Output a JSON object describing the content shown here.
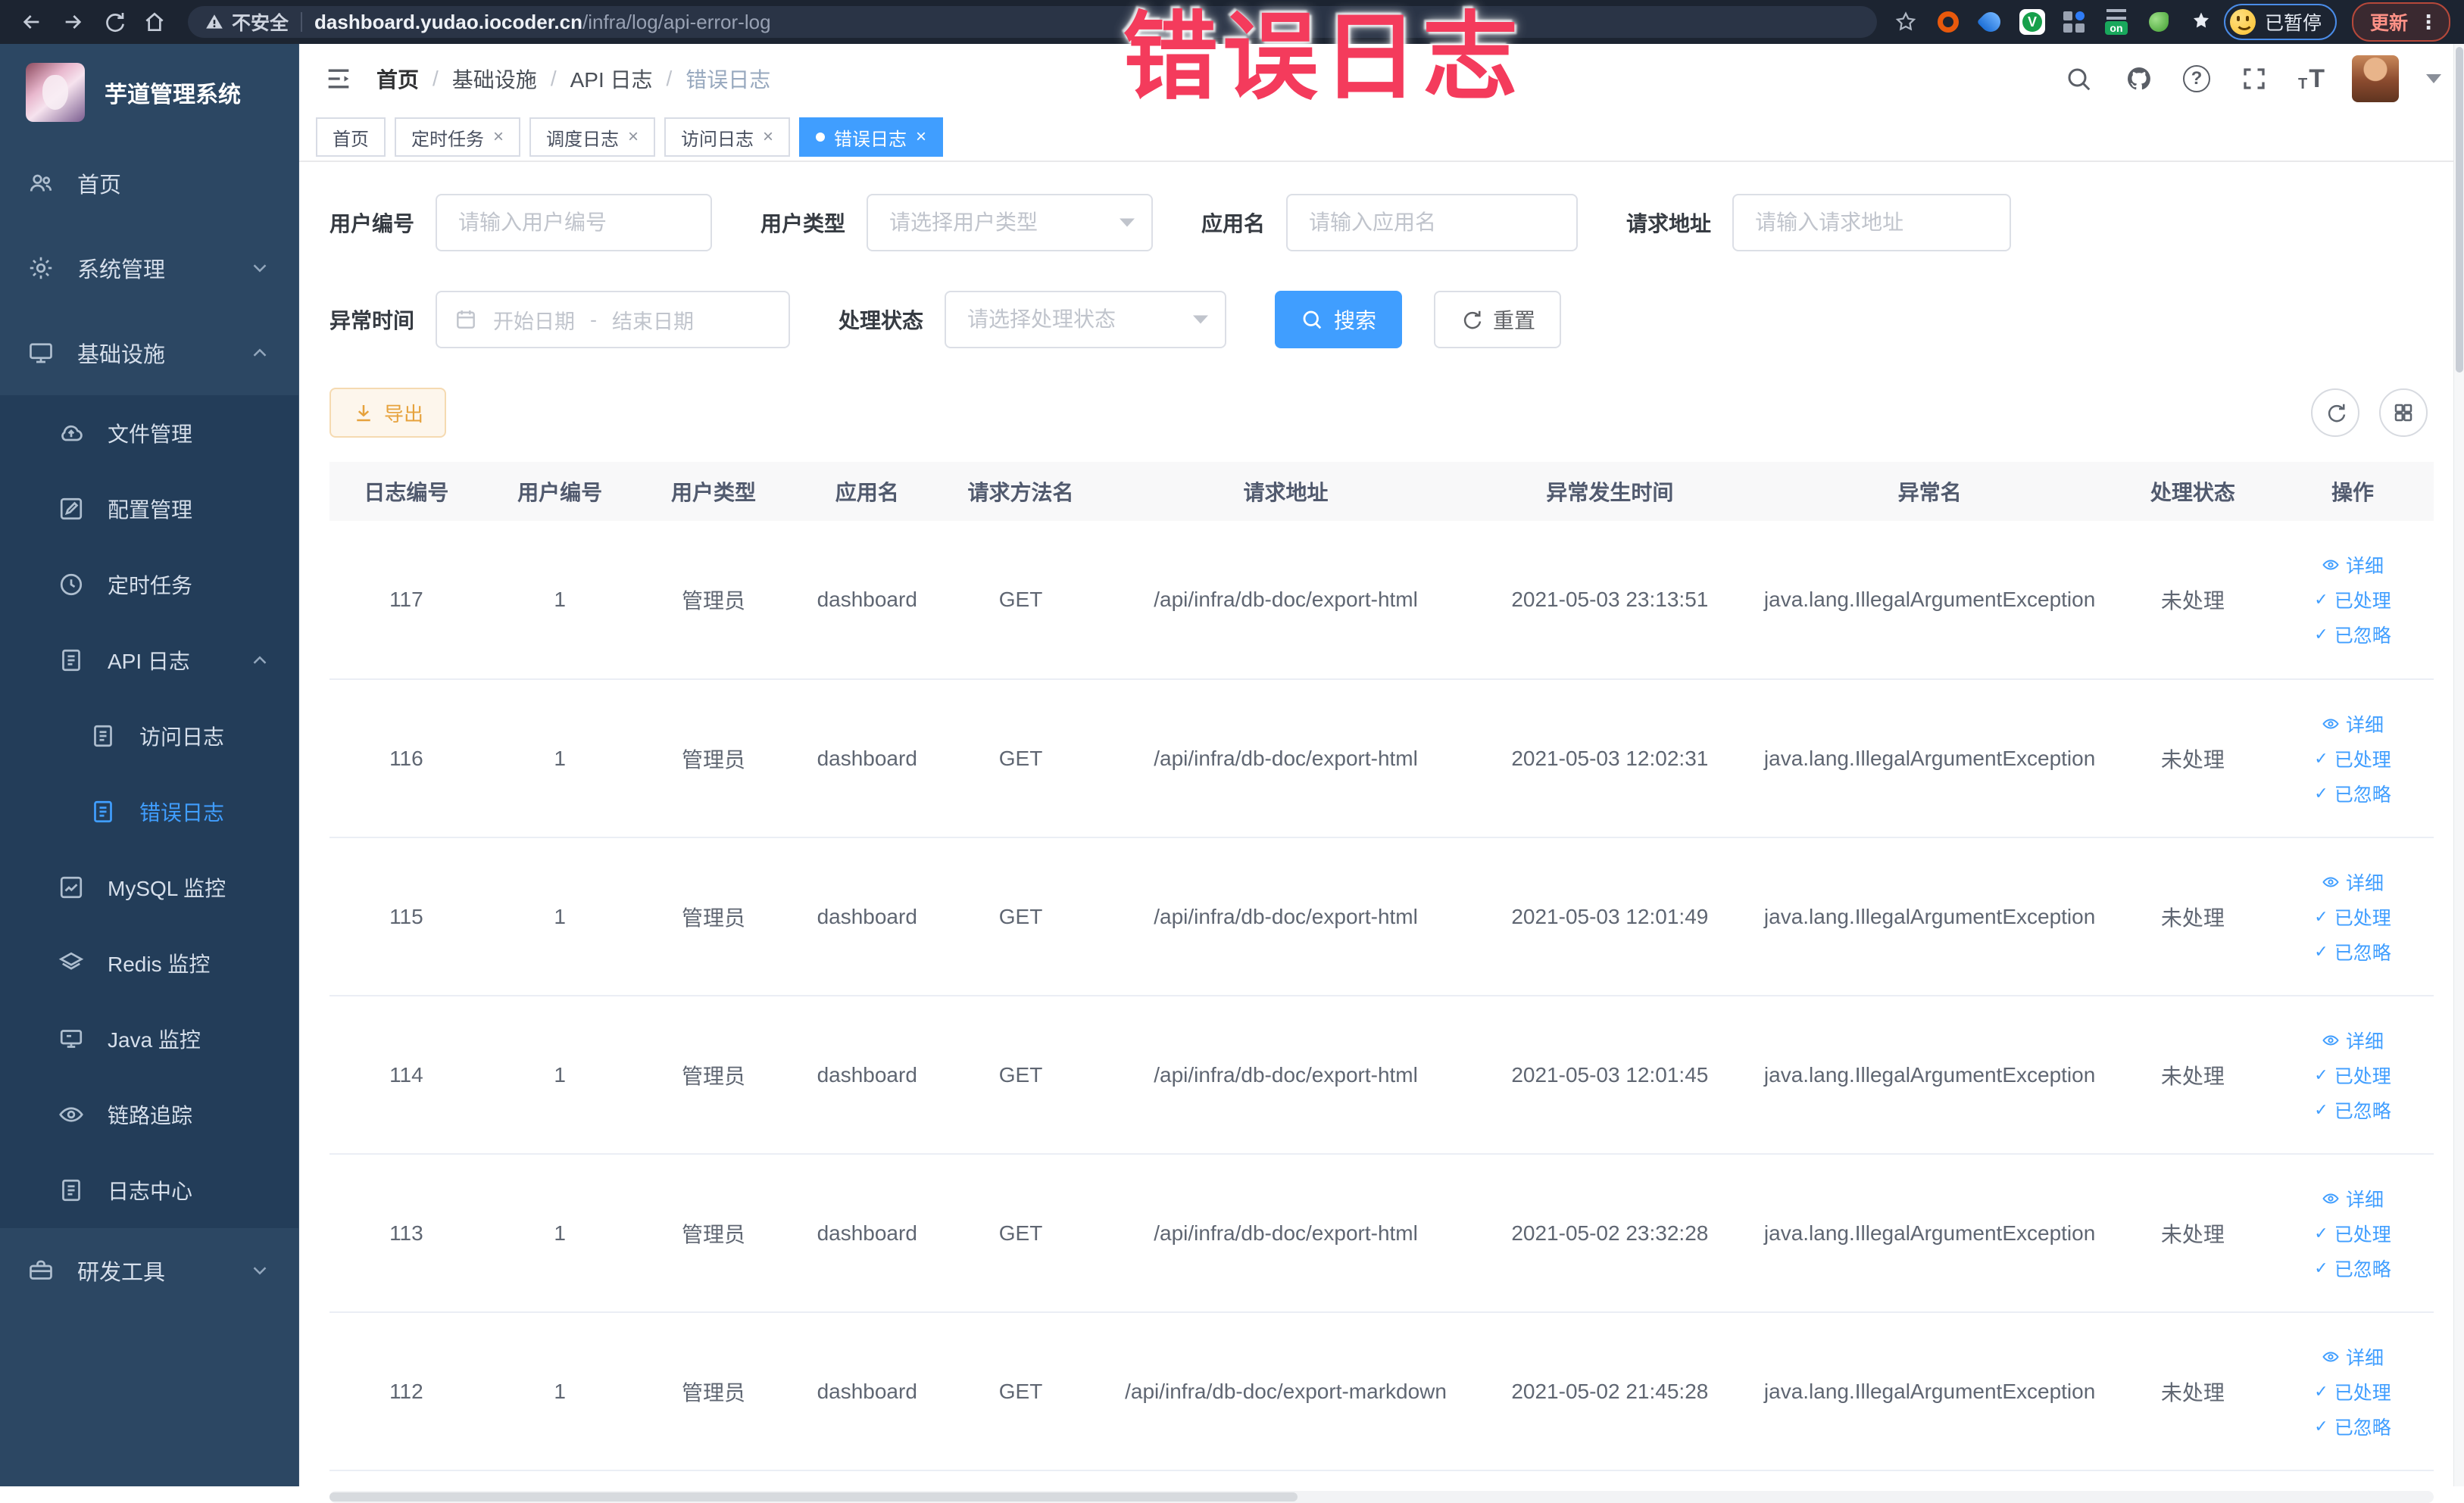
{
  "browser": {
    "security_label": "不安全",
    "url_domain": "dashboard.yudao.iocoder.cn",
    "url_path": "/infra/log/api-error-log",
    "extension_on_label": "on",
    "paused_label": "已暂停",
    "update_label": "更新",
    "kebab": "⋮"
  },
  "overlay": {
    "text": "错误日志",
    "color": "#f43b5c"
  },
  "sidebar": {
    "title": "芋道管理系统",
    "home": "首页",
    "system": "系统管理",
    "infra": "基础设施",
    "file": "文件管理",
    "config": "配置管理",
    "job": "定时任务",
    "api_log": "API 日志",
    "access_log": "访问日志",
    "error_log": "错误日志",
    "mysql": "MySQL 监控",
    "redis": "Redis 监控",
    "java": "Java 监控",
    "trace": "链路追踪",
    "log_center": "日志中心",
    "devtools": "研发工具"
  },
  "header": {
    "breadcrumb": [
      "首页",
      "基础设施",
      "API 日志",
      "错误日志"
    ]
  },
  "tags": {
    "items": [
      {
        "label": "首页"
      },
      {
        "label": "定时任务"
      },
      {
        "label": "调度日志"
      },
      {
        "label": "访问日志"
      },
      {
        "label": "错误日志"
      }
    ],
    "close_glyph": "×"
  },
  "filters": {
    "user_id": {
      "label": "用户编号",
      "placeholder": "请输入用户编号"
    },
    "user_type": {
      "label": "用户类型",
      "placeholder": "请选择用户类型"
    },
    "app_name": {
      "label": "应用名",
      "placeholder": "请输入应用名"
    },
    "request_url": {
      "label": "请求地址",
      "placeholder": "请输入请求地址"
    },
    "exception_time": {
      "label": "异常时间",
      "start_placeholder": "开始日期",
      "separator": "-",
      "end_placeholder": "结束日期"
    },
    "process_status": {
      "label": "处理状态",
      "placeholder": "请选择处理状态"
    },
    "search_label": "搜索",
    "reset_label": "重置"
  },
  "toolbar": {
    "export_label": "导出"
  },
  "table": {
    "columns": [
      "日志编号",
      "用户编号",
      "用户类型",
      "应用名",
      "请求方法名",
      "请求地址",
      "异常发生时间",
      "异常名",
      "处理状态",
      "操作"
    ],
    "row_actions": [
      "详细",
      "已处理",
      "已忽略"
    ],
    "check_glyph": "✓",
    "rows": [
      {
        "id": "117",
        "user_id": "1",
        "user_type": "管理员",
        "app": "dashboard",
        "method": "GET",
        "url": "/api/infra/db-doc/export-html",
        "time": "2021-05-03 23:13:51",
        "exception": "java.lang.IllegalArgumentException",
        "status": "未处理"
      },
      {
        "id": "116",
        "user_id": "1",
        "user_type": "管理员",
        "app": "dashboard",
        "method": "GET",
        "url": "/api/infra/db-doc/export-html",
        "time": "2021-05-03 12:02:31",
        "exception": "java.lang.IllegalArgumentException",
        "status": "未处理"
      },
      {
        "id": "115",
        "user_id": "1",
        "user_type": "管理员",
        "app": "dashboard",
        "method": "GET",
        "url": "/api/infra/db-doc/export-html",
        "time": "2021-05-03 12:01:49",
        "exception": "java.lang.IllegalArgumentException",
        "status": "未处理"
      },
      {
        "id": "114",
        "user_id": "1",
        "user_type": "管理员",
        "app": "dashboard",
        "method": "GET",
        "url": "/api/infra/db-doc/export-html",
        "time": "2021-05-03 12:01:45",
        "exception": "java.lang.IllegalArgumentException",
        "status": "未处理"
      },
      {
        "id": "113",
        "user_id": "1",
        "user_type": "管理员",
        "app": "dashboard",
        "method": "GET",
        "url": "/api/infra/db-doc/export-html",
        "time": "2021-05-02 23:32:28",
        "exception": "java.lang.IllegalArgumentException",
        "status": "未处理"
      },
      {
        "id": "112",
        "user_id": "1",
        "user_type": "管理员",
        "app": "dashboard",
        "method": "GET",
        "url": "/api/infra/db-doc/export-markdown",
        "time": "2021-05-02 21:45:28",
        "exception": "java.lang.IllegalArgumentException",
        "status": "未处理"
      }
    ]
  },
  "colors": {
    "accent": "#409eff",
    "overlay_red": "#f43b5c",
    "export_orange": "#e6a23c",
    "sidebar_bg": "#2c4763",
    "submenu_bg": "#233d59"
  }
}
